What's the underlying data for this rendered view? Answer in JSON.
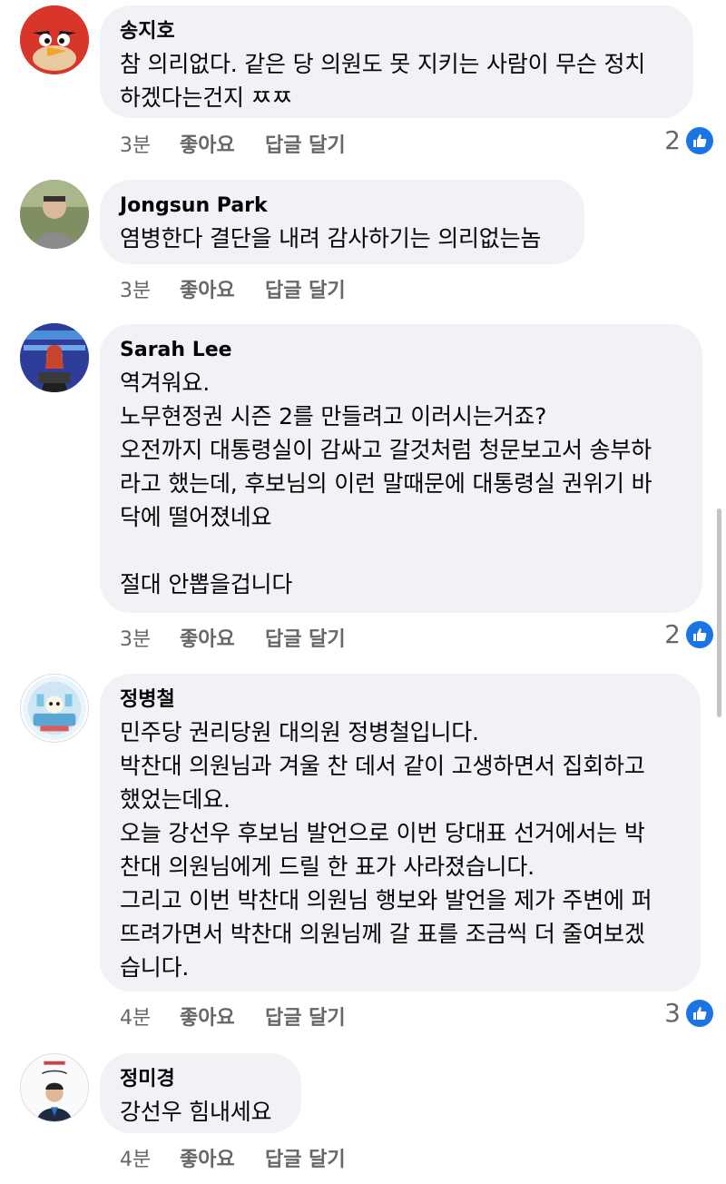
{
  "comments": [
    {
      "author": "송지호",
      "text": "참 의리없다. 같은 당 의원도 못 지키는 사람이 무슨 정치\n하겠다는건지 ㅉㅉ",
      "time": "3분",
      "like_label": "좋아요",
      "reply_label": "답글 달기",
      "reaction_count": "2",
      "avatar_icon": "angry-bird-icon"
    },
    {
      "author": "Jongsun Park",
      "text": "염병한다 결단을 내려 감사하기는 의리없는놈",
      "time": "3분",
      "like_label": "좋아요",
      "reply_label": "답글 달기",
      "reaction_count": "",
      "avatar_icon": "person-photo-icon"
    },
    {
      "author": "Sarah Lee",
      "text": "역겨워요.\n노무현정권 시즌 2를 만들려고 이러시는거죠?\n오전까지 대통령실이 감싸고 갈것처럼 청문보고서 송부하\n라고 했는데, 후보님의 이런 말때문에 대통령실 권위기 바\n닥에 떨어졌네요\n\n절대 안뽑을겁니다",
      "time": "3분",
      "like_label": "좋아요",
      "reply_label": "답글 달기",
      "reaction_count": "2",
      "avatar_icon": "person-photo-icon"
    },
    {
      "author": "정병철",
      "text": "민주당 권리당원 대의원 정병철입니다.\n박찬대 의원님과 겨울 찬 데서 같이 고생하면서 집회하고\n했었는데요.\n오늘 강선우 후보님 발언으로 이번 당대표 선거에서는 박\n찬대 의원님에게 드릴 한 표가 사라졌습니다.\n그리고 이번 박찬대 의원님 행보와 발언을 제가 주변에 퍼\n뜨려가면서 박찬대 의원님께 갈 표를 조금씩 더 줄여보겠\n습니다.",
      "time": "4분",
      "like_label": "좋아요",
      "reply_label": "답글 달기",
      "reaction_count": "3",
      "avatar_icon": "illustration-icon"
    },
    {
      "author": "정미경",
      "text": "강선우 힘내세요",
      "time": "4분",
      "like_label": "좋아요",
      "reply_label": "답글 달기",
      "reaction_count": "",
      "avatar_icon": "person-photo-icon"
    }
  ],
  "colors": {
    "bubble": "#f0f2f5",
    "meta": "#65676b",
    "like_badge": "#1b74e4"
  }
}
